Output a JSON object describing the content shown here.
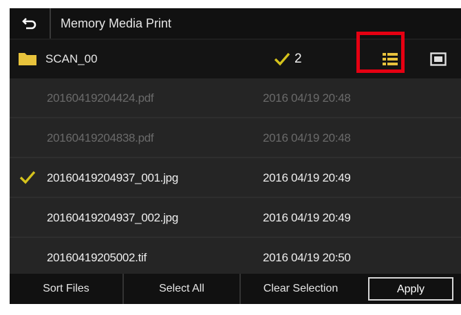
{
  "header": {
    "title": "Memory Media Print",
    "back_icon": "back-arrow-icon"
  },
  "folder": {
    "name": "SCAN_00",
    "selected_count": "2",
    "list_view_icon": "list-view-icon",
    "thumbnail_view_icon": "thumbnail-view-icon"
  },
  "files": [
    {
      "name": "20160419204424.pdf",
      "date": "2016 04/19 20:48",
      "selected": false,
      "disabled": true
    },
    {
      "name": "20160419204838.pdf",
      "date": "2016 04/19 20:48",
      "selected": false,
      "disabled": true
    },
    {
      "name": "20160419204937_001.jpg",
      "date": "2016 04/19 20:49",
      "selected": true,
      "disabled": false
    },
    {
      "name": "20160419204937_002.jpg",
      "date": "2016 04/19 20:49",
      "selected": false,
      "disabled": false
    },
    {
      "name": "20160419205002.tif",
      "date": "2016 04/19 20:50",
      "selected": false,
      "disabled": false
    }
  ],
  "footer": {
    "sort_label": "Sort Files",
    "select_all_label": "Select All",
    "clear_label": "Clear Selection",
    "apply_label": "Apply"
  },
  "colors": {
    "check": "#d4c21c",
    "highlight": "#e60012",
    "folder": "#e8c33c"
  }
}
